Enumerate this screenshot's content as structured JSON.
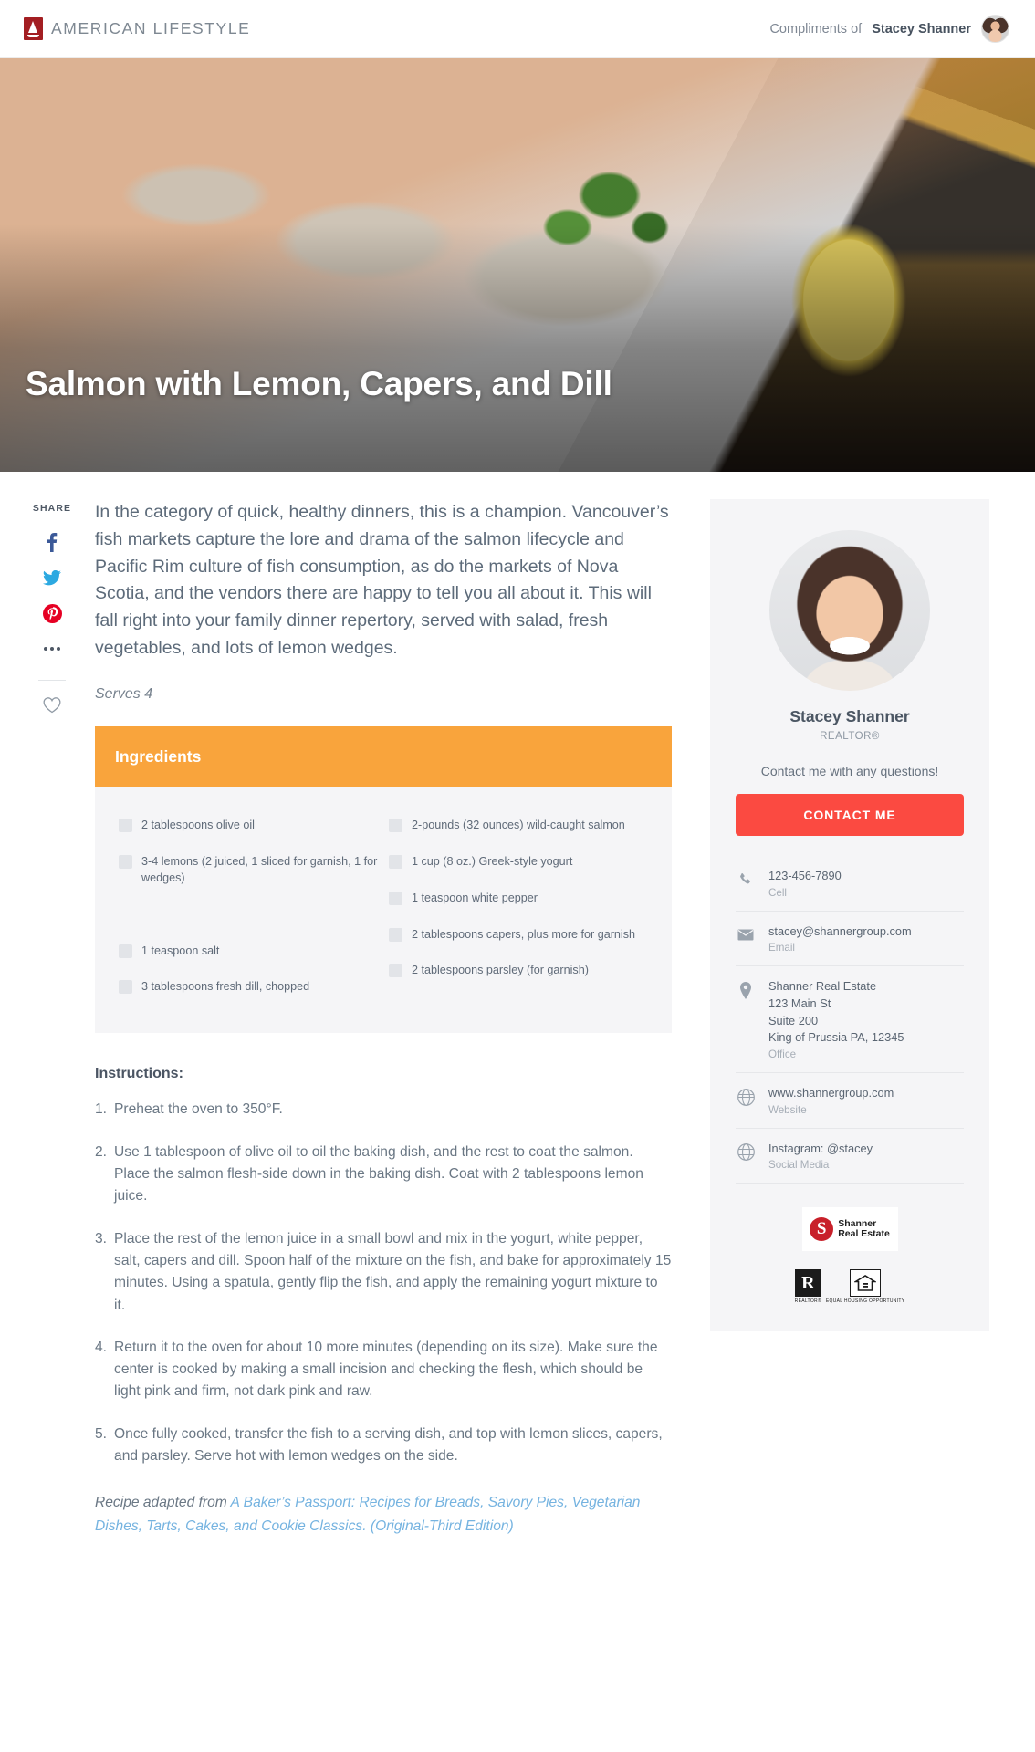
{
  "header": {
    "brand": "AMERICAN LIFESTYLE",
    "compliments_prefix": "Compliments of ",
    "compliments_name": "Stacey Shanner"
  },
  "hero": {
    "title": "Salmon with Lemon, Capers, and Dill"
  },
  "share": {
    "label": "SHARE",
    "items": [
      {
        "name": "facebook",
        "glyph": "f"
      },
      {
        "name": "twitter",
        "glyph": "🐦"
      },
      {
        "name": "pinterest",
        "glyph": "P"
      },
      {
        "name": "more",
        "glyph": "•••"
      },
      {
        "name": "favorite",
        "glyph": "♡"
      }
    ]
  },
  "article": {
    "intro": "In the category of quick, healthy dinners, this is a champion. Vancouver’s fish markets capture the lore and drama of the salmon lifecycle and Pacific Rim culture of fish consumption, as do the markets of Nova Scotia, and the vendors there are happy to tell you all about it. This will fall right into your family dinner repertory, served with salad, fresh vegetables, and lots of lemon wedges.",
    "serves": "Serves 4",
    "ingredients_heading": "Ingredients",
    "ingredients_left": [
      "2 tablespoons olive oil",
      "3-4 lemons (2 juiced, 1 sliced for garnish, 1 for wedges)",
      "1 teaspoon salt",
      "3 tablespoons fresh dill, chopped"
    ],
    "ingredients_right": [
      "2-pounds (32 ounces) wild-caught salmon",
      "1 cup (8 oz.) Greek-style yogurt",
      "1 teaspoon white pepper",
      "2 tablespoons capers, plus more for garnish",
      "2 tablespoons parsley (for garnish)"
    ],
    "instructions_heading": "Instructions:",
    "steps": [
      {
        "num": "1.",
        "text": "Preheat the oven to 350°F."
      },
      {
        "num": "2.",
        "text": "Use 1 tablespoon of olive oil to oil the baking dish, and the rest to coat the salmon. Place the salmon flesh-side down in the baking dish. Coat with 2 tablespoons lemon juice."
      },
      {
        "num": "3.",
        "text": "Place the rest of the lemon juice in a small bowl and mix in the yogurt, white pepper, salt, capers and dill. Spoon half of the mixture on the fish, and bake for approximately 15 minutes. Using a spatula, gently flip the fish, and apply the remaining yogurt mixture to it."
      },
      {
        "num": "4.",
        "text": "Return it to the oven for about 10 more minutes (depending on its size). Make sure the center is cooked by making a small incision and checking the flesh, which should be light pink and firm, not dark pink and raw."
      },
      {
        "num": "5.",
        "text": "Once fully cooked, transfer the fish to a serving dish, and top with lemon slices, capers, and parsley. Serve hot with lemon wedges on the side."
      }
    ],
    "credit_prefix": "Recipe adapted from ",
    "credit_link": "A Baker’s Passport: Recipes for Breads, Savory Pies, Vegetarian Dishes, Tarts, Cakes, and Cookie Classics. (Original-Third Edition)"
  },
  "sidebar": {
    "agent_name": "Stacey Shanner",
    "agent_role": "REALTOR®",
    "tagline": "Contact me with any questions!",
    "cta": "CONTACT ME",
    "contacts": [
      {
        "icon": "phone-icon",
        "value": "123-456-7890",
        "label": "Cell"
      },
      {
        "icon": "email-icon",
        "value": "stacey@shannergroup.com",
        "label": "Email"
      },
      {
        "icon": "location-icon",
        "value": "Shanner Real Estate\n123 Main St\nSuite 200\nKing of Prussia PA, 12345",
        "label": "Office"
      },
      {
        "icon": "globe-icon",
        "value": "www.shannergroup.com",
        "label": "Website"
      },
      {
        "icon": "globe-icon",
        "value": "Instagram: @stacey",
        "label": "Social Media"
      }
    ],
    "brokerage_line1": "Shanner",
    "brokerage_line2": "Real Estate",
    "brokerage_monogram": "S",
    "realtor_mark": "R",
    "realtor_caption": "REALTOR®",
    "eho_caption": "EQUAL HOUSING OPPORTUNITY"
  },
  "colors": {
    "accent_orange": "#f9a43c",
    "cta_red": "#fb4a41",
    "brand_red": "#a31e22",
    "link_blue": "#75b3e0",
    "text": "#5a6673"
  }
}
